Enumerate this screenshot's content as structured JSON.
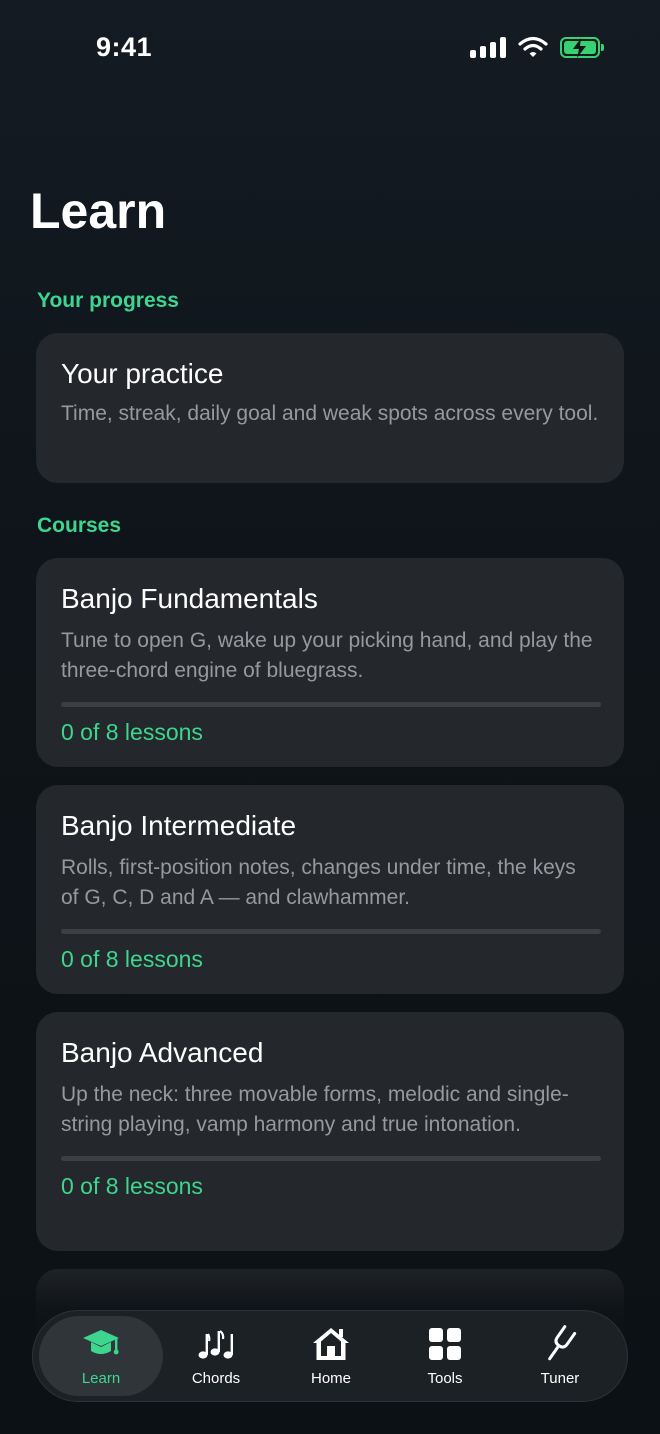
{
  "status_bar": {
    "time": "9:41"
  },
  "header": {
    "title": "Learn"
  },
  "sections": {
    "progress_label": "Your progress",
    "courses_label": "Courses"
  },
  "practice_card": {
    "title": "Your practice",
    "description": "Time, streak, daily goal and weak spots across every tool."
  },
  "courses": [
    {
      "title": "Banjo Fundamentals",
      "description": "Tune to open G, wake up your picking hand, and play the three-chord engine of bluegrass.",
      "progress_text": "0 of 8 lessons",
      "progress": 0
    },
    {
      "title": "Banjo Intermediate",
      "description": "Rolls, first-position notes, changes under time, the keys of G, C, D and A — and clawhammer.",
      "progress_text": "0 of 8 lessons",
      "progress": 0
    },
    {
      "title": "Banjo Advanced",
      "description": "Up the neck: three movable forms, melodic and single-string playing, vamp harmony and true intonation.",
      "progress_text": "0 of 8 lessons",
      "progress": 0
    }
  ],
  "tab_bar": {
    "tabs": [
      {
        "label": "Learn",
        "icon": "graduation-cap-icon",
        "active": true
      },
      {
        "label": "Chords",
        "icon": "music-notes-icon",
        "active": false
      },
      {
        "label": "Home",
        "icon": "house-icon",
        "active": false
      },
      {
        "label": "Tools",
        "icon": "grid-icon",
        "active": false
      },
      {
        "label": "Tuner",
        "icon": "tuning-fork-icon",
        "active": false
      }
    ]
  },
  "colors": {
    "accent": "#3ed68f",
    "card_bg": "#24272b",
    "background": "#0f151b",
    "battery": "#37d172"
  }
}
